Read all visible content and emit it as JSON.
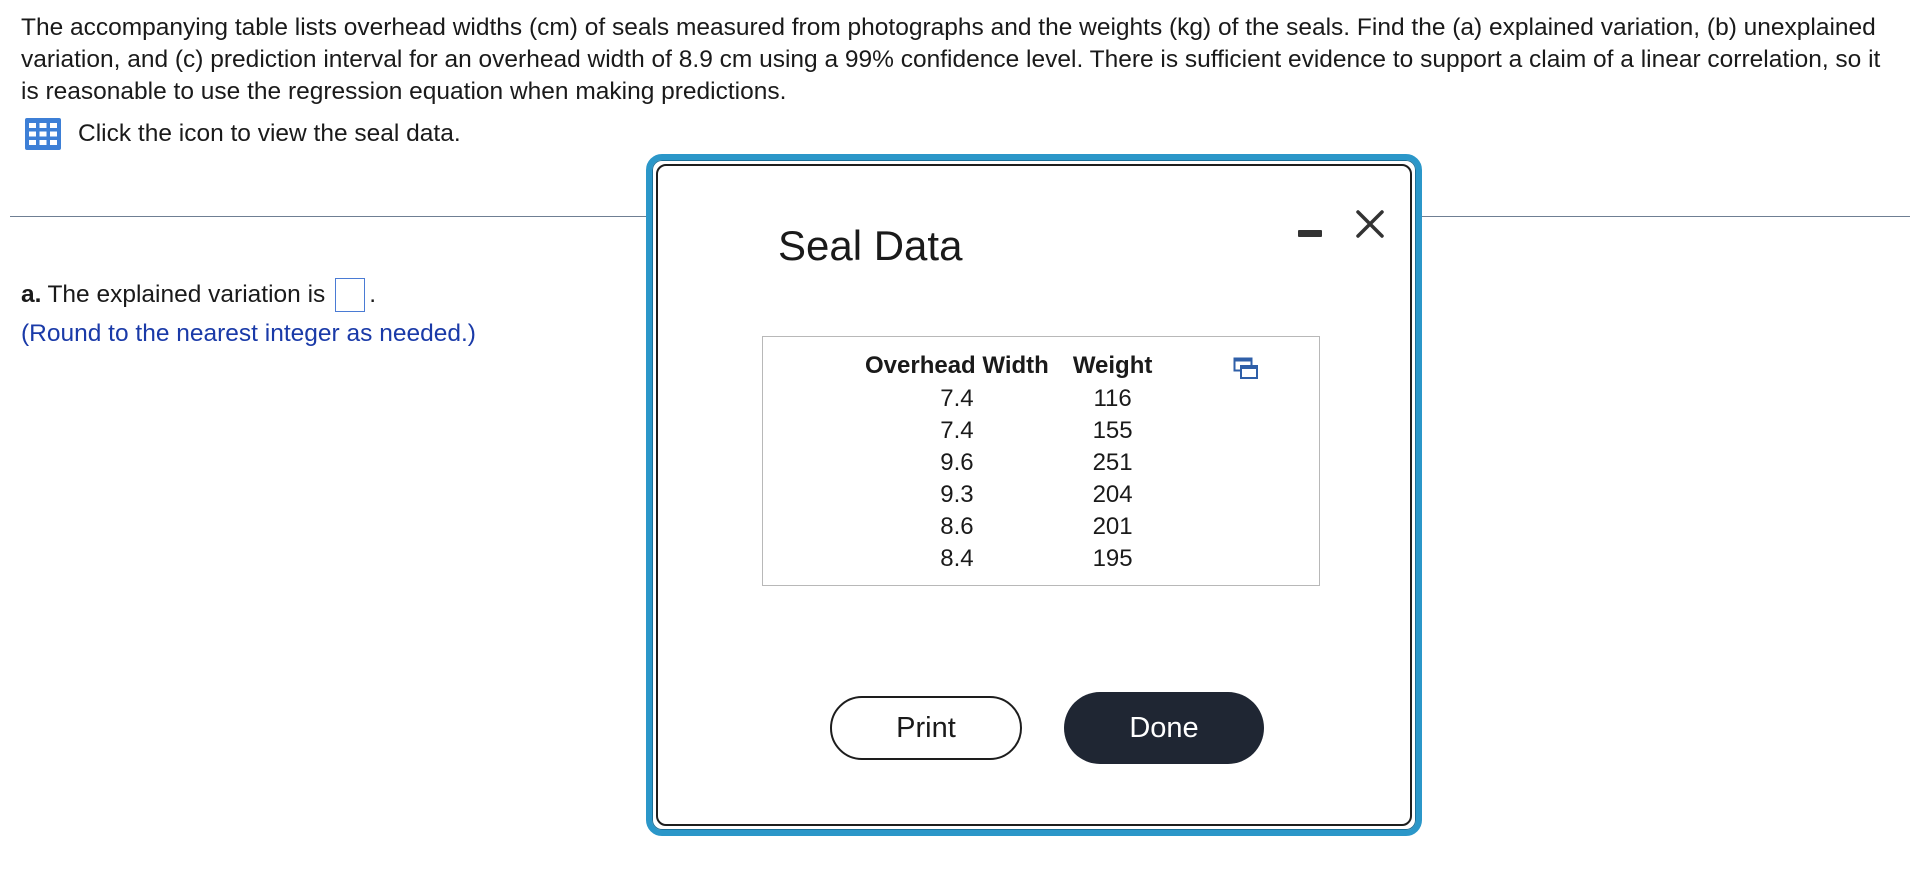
{
  "question": {
    "text": "The accompanying table lists overhead widths (cm) of seals measured from photographs and the weights (kg) of the seals. Find the (a) explained variation, (b) unexplained variation, and (c) prediction interval for an overhead width of 8.9 cm using a 99% confidence level. There is sufficient evidence to support a claim of a linear correlation, so it is reasonable to use the regression equation when making predictions.",
    "data_link_text": "Click the icon to view the seal data."
  },
  "part_a": {
    "label": "a.",
    "text": "The explained variation is",
    "answer_value": "",
    "after": ".",
    "hint": "(Round to the nearest integer as needed.)"
  },
  "modal": {
    "title": "Seal Data",
    "columns": [
      "Overhead Width",
      "Weight"
    ],
    "rows": [
      [
        "7.4",
        "116"
      ],
      [
        "7.4",
        "155"
      ],
      [
        "9.6",
        "251"
      ],
      [
        "9.3",
        "204"
      ],
      [
        "8.6",
        "201"
      ],
      [
        "8.4",
        "195"
      ]
    ],
    "print_label": "Print",
    "done_label": "Done"
  },
  "icons": {
    "data_table": "table-icon",
    "copy": "copy-icon",
    "minimize": "minimize-icon",
    "close": "close-icon"
  },
  "colors": {
    "accent_border": "#2b97c9",
    "hint_text": "#1a3aa8",
    "done_button": "#1f2633",
    "answer_box_border": "#4a7bd4"
  }
}
